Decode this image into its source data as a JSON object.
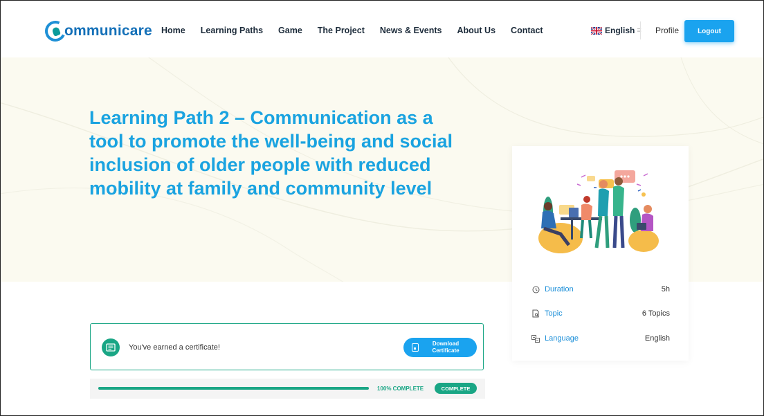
{
  "brand": {
    "logo_text": "ommunicare"
  },
  "nav": {
    "items": [
      "Home",
      "Learning Paths",
      "Game",
      "The Project",
      "News & Events",
      "About Us",
      "Contact"
    ]
  },
  "header": {
    "language": "English",
    "profile": "Profile",
    "logout": "Logout"
  },
  "hero": {
    "title": "Learning Path 2 – Communication as a tool to promote the well-being and social inclusion of older people with reduced mobility at family and community level"
  },
  "course_info": {
    "duration_label": "Duration",
    "duration_value": "5h",
    "topic_label": "Topic",
    "topic_value": "6 Topics",
    "language_label": "Language",
    "language_value": "English"
  },
  "certificate": {
    "message": "You've earned a certificate!",
    "download_label": "Download Certificate"
  },
  "progress": {
    "percent": 100,
    "label": "100% COMPLETE",
    "badge": "COMPLETE"
  },
  "colors": {
    "accent_blue": "#1aa3ef",
    "title_blue": "#1aa3e0",
    "success_green": "#1aa685",
    "hero_bg": "#fbfaf0"
  }
}
